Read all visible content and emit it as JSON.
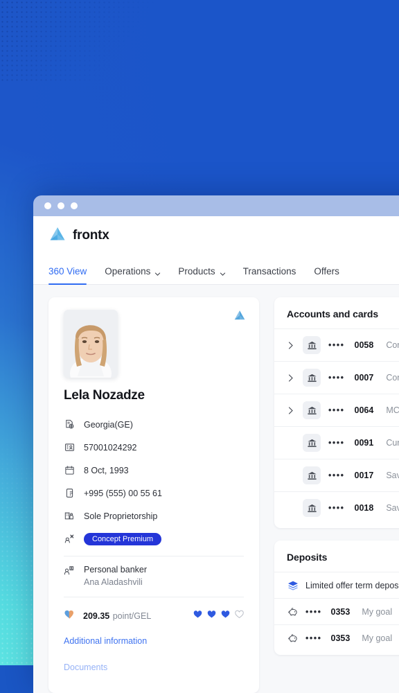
{
  "window": {
    "dots": [
      "close",
      "minimize",
      "maximize"
    ]
  },
  "header": {
    "brand": "frontx",
    "logo_icon": "frontx-triangle-logo"
  },
  "nav": {
    "tabs": [
      {
        "label": "360 View",
        "active": true,
        "dropdown": false
      },
      {
        "label": "Operations",
        "active": false,
        "dropdown": true
      },
      {
        "label": "Products",
        "active": false,
        "dropdown": true
      },
      {
        "label": "Transactions",
        "active": false,
        "dropdown": false
      },
      {
        "label": "Offers",
        "active": false,
        "dropdown": false
      }
    ],
    "accent_color": "#2f6bf2"
  },
  "profile": {
    "corner_logo_icon": "frontx-triangle-logo",
    "avatar_icon": "customer-portrait-photo",
    "name": "Lela Nozadze",
    "fields": [
      {
        "icon": "document-globe-icon",
        "value": "Georgia(GE)"
      },
      {
        "icon": "id-card-icon",
        "value": "57001024292"
      },
      {
        "icon": "calendar-icon",
        "value": "8 Oct, 1993"
      },
      {
        "icon": "phone-icon",
        "value": "+995 (555) 00 55 61"
      },
      {
        "icon": "business-icon",
        "value": "Sole Proprietorship"
      }
    ],
    "segment": {
      "icon": "person-star-icon",
      "badge_label": "Concept Premium",
      "badge_color": "#2435d8"
    },
    "banker": {
      "icon": "person-badge-icon",
      "title": "Personal banker",
      "name": "Ana Aladashvili"
    },
    "points": {
      "icon": "loyalty-heart-icon",
      "value": "209.35",
      "unit": "point/GEL",
      "hearts_filled": 3,
      "hearts_total": 4,
      "heart_color": "#2f5ae0"
    },
    "links": [
      {
        "label": "Additional information"
      },
      {
        "label": "Documents"
      }
    ]
  },
  "accounts": {
    "title": "Accounts and cards",
    "rows": [
      {
        "expandable": true,
        "icon": "bank-icon",
        "mask": "••••",
        "number": "0058",
        "label": "Concept"
      },
      {
        "expandable": true,
        "icon": "bank-icon",
        "mask": "••••",
        "number": "0007",
        "label": "Concept"
      },
      {
        "expandable": true,
        "icon": "bank-icon",
        "mask": "••••",
        "number": "0064",
        "label": "MC GO"
      },
      {
        "expandable": false,
        "icon": "bank-icon",
        "mask": "••••",
        "number": "0091",
        "label": "Current"
      },
      {
        "expandable": false,
        "icon": "bank-icon",
        "mask": "••••",
        "number": "0017",
        "label": "Savings"
      },
      {
        "expandable": false,
        "icon": "bank-icon",
        "mask": "••••",
        "number": "0018",
        "label": "Savings"
      }
    ]
  },
  "deposits": {
    "title": "Deposits",
    "offer": {
      "icon": "layers-icon",
      "label": "Limited offer term deposit"
    },
    "rows": [
      {
        "icon": "piggy-bank-icon",
        "mask": "••••",
        "number": "0353",
        "label": "My goal"
      },
      {
        "icon": "piggy-bank-icon",
        "mask": "••••",
        "number": "0353",
        "label": "My goal"
      }
    ]
  }
}
